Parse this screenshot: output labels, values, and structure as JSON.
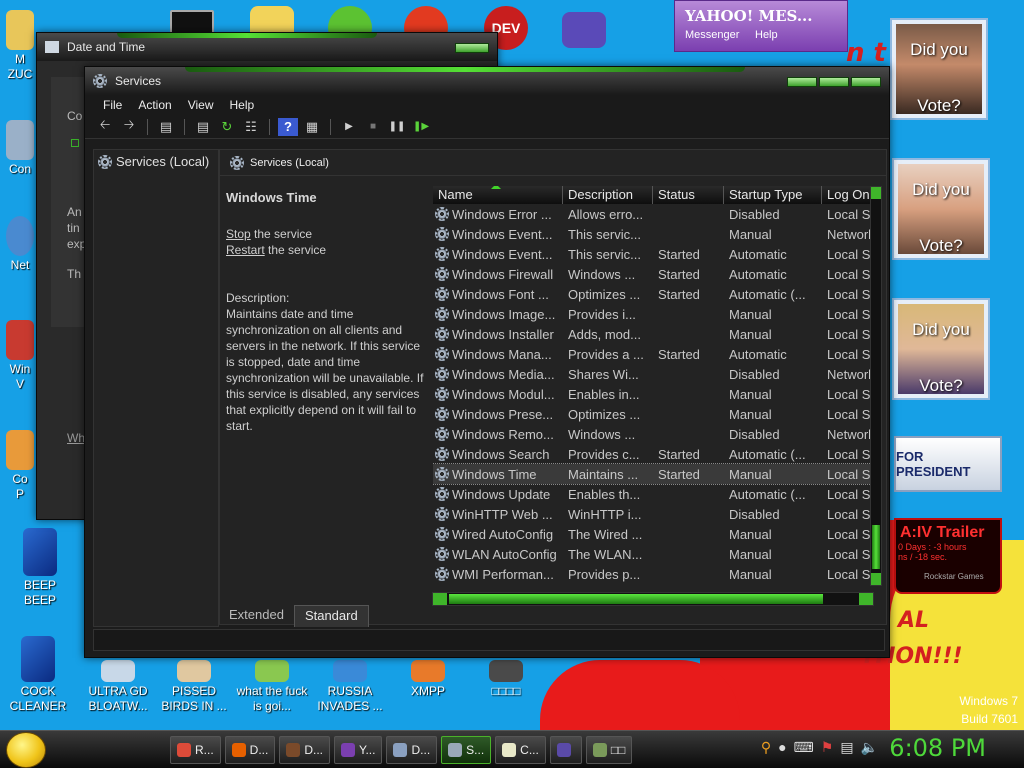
{
  "desktop": {
    "top_icons": [
      "cmd",
      "folder",
      "game",
      "dev",
      "gameboy"
    ],
    "left_icons": [
      {
        "label_lines": [
          "M",
          "ZUC"
        ]
      },
      {
        "label_lines": [
          "Con"
        ]
      },
      {
        "label_lines": [
          "Net"
        ]
      },
      {
        "label_lines": [
          "Win",
          "V"
        ]
      },
      {
        "label_lines": [
          "Co",
          "P"
        ]
      }
    ],
    "beep_label": "BEEP BEEP",
    "bottom_icons": [
      {
        "label": "COCK CLEANER"
      },
      {
        "label": "ULTRA GD BLOATW..."
      },
      {
        "label": "PISSED BIRDS IN ..."
      },
      {
        "label": "what the fuck is goi..."
      },
      {
        "label": "RUSSIA INVADES ..."
      },
      {
        "label": "XMPP"
      },
      {
        "label": "□□□□"
      }
    ],
    "ads": {
      "obama": {
        "line1": "Did you",
        "line2": "Vote?"
      },
      "mccain": {
        "line1": "Did you",
        "line2": "Vote?"
      },
      "clinton": {
        "line1": "Did you",
        "line2": "Vote?"
      },
      "president": "FOR PRESIDENT",
      "gta": {
        "title": "A:IV Trailer",
        "line1": "0 Days : -3 hours",
        "line2": "ns / -18 sec.",
        "footer": "Rockstar Games"
      }
    },
    "banner": {
      "line1": "AL",
      "line2": "ITION!!!",
      "fragment": "n t"
    },
    "yahoo": {
      "brand": "YAHOO! MES...",
      "menu1": "Messenger",
      "menu2": "Help"
    },
    "watermark": {
      "line1": "Windows 7",
      "line2": "Build 7601"
    }
  },
  "datetime_window": {
    "title": "Date and Time",
    "fragments": [
      "Co",
      "An",
      "tin",
      "exp",
      "Th",
      "Wh"
    ]
  },
  "services_window": {
    "title": "Services",
    "menu": [
      "File",
      "Action",
      "View",
      "Help"
    ],
    "tree_item": "Services (Local)",
    "content_header": "Services (Local)",
    "selected_service": {
      "name": "Windows Time",
      "stop_link": "Stop",
      "stop_rest": " the service",
      "restart_link": "Restart",
      "restart_rest": " the service",
      "description_label": "Description:",
      "description": "Maintains date and time synchronization on all clients and servers in the network. If this service is stopped, date and time synchronization will be unavailable. If this service is disabled, any services that explicitly depend on it will fail to start."
    },
    "columns": [
      "Name",
      "Description",
      "Status",
      "Startup Type",
      "Log On"
    ],
    "rows": [
      {
        "name": "Windows Error ...",
        "desc": "Allows erro...",
        "status": "",
        "startup": "Disabled",
        "logon": "Local S"
      },
      {
        "name": "Windows Event...",
        "desc": "This servic...",
        "status": "",
        "startup": "Manual",
        "logon": "Network"
      },
      {
        "name": "Windows Event...",
        "desc": "This servic...",
        "status": "Started",
        "startup": "Automatic",
        "logon": "Local S"
      },
      {
        "name": "Windows Firewall",
        "desc": "Windows ...",
        "status": "Started",
        "startup": "Automatic",
        "logon": "Local S"
      },
      {
        "name": "Windows Font ...",
        "desc": "Optimizes ...",
        "status": "Started",
        "startup": "Automatic (...",
        "logon": "Local S"
      },
      {
        "name": "Windows Image...",
        "desc": "Provides i...",
        "status": "",
        "startup": "Manual",
        "logon": "Local S"
      },
      {
        "name": "Windows Installer",
        "desc": "Adds, mod...",
        "status": "",
        "startup": "Manual",
        "logon": "Local S"
      },
      {
        "name": "Windows Mana...",
        "desc": "Provides a ...",
        "status": "Started",
        "startup": "Automatic",
        "logon": "Local S"
      },
      {
        "name": "Windows Media...",
        "desc": "Shares Wi...",
        "status": "",
        "startup": "Disabled",
        "logon": "Network"
      },
      {
        "name": "Windows Modul...",
        "desc": "Enables in...",
        "status": "",
        "startup": "Manual",
        "logon": "Local S"
      },
      {
        "name": "Windows Prese...",
        "desc": "Optimizes ...",
        "status": "",
        "startup": "Manual",
        "logon": "Local S"
      },
      {
        "name": "Windows Remo...",
        "desc": "Windows ...",
        "status": "",
        "startup": "Disabled",
        "logon": "Network"
      },
      {
        "name": "Windows Search",
        "desc": "Provides c...",
        "status": "Started",
        "startup": "Automatic (...",
        "logon": "Local S"
      },
      {
        "name": "Windows Time",
        "desc": "Maintains ...",
        "status": "Started",
        "startup": "Manual",
        "logon": "Local S"
      },
      {
        "name": "Windows Update",
        "desc": "Enables th...",
        "status": "",
        "startup": "Automatic (...",
        "logon": "Local S"
      },
      {
        "name": "WinHTTP Web ...",
        "desc": "WinHTTP i...",
        "status": "",
        "startup": "Disabled",
        "logon": "Local S"
      },
      {
        "name": "Wired AutoConfig",
        "desc": "The Wired ...",
        "status": "",
        "startup": "Manual",
        "logon": "Local S"
      },
      {
        "name": "WLAN AutoConfig",
        "desc": "The WLAN...",
        "status": "",
        "startup": "Manual",
        "logon": "Local S"
      },
      {
        "name": "WMI Performan...",
        "desc": "Provides p...",
        "status": "",
        "startup": "Manual",
        "logon": "Local S"
      }
    ],
    "selected_row_index": 13,
    "tabs": [
      "Extended",
      "Standard"
    ],
    "active_tab": "Standard"
  },
  "taskbar": {
    "items": [
      {
        "label": "R...",
        "color": "#dd4b39"
      },
      {
        "label": "D...",
        "color": "#e66000"
      },
      {
        "label": "D...",
        "color": "#7a4a2a"
      },
      {
        "label": "Y...",
        "color": "#7b3fb0"
      },
      {
        "label": "D...",
        "color": "#8aa0c0"
      },
      {
        "label": "S...",
        "color": "#9aa8b8"
      },
      {
        "label": "C...",
        "color": "#e8e8c8"
      },
      {
        "label": "",
        "color": "#5a4aa8"
      },
      {
        "label": "□□",
        "color": "#7a9a5a"
      }
    ],
    "active_index": 5,
    "clock": "6:08 PM"
  },
  "colors": {
    "accent_green": "#4ed93a",
    "desktop_blue": "#16a0e6"
  }
}
